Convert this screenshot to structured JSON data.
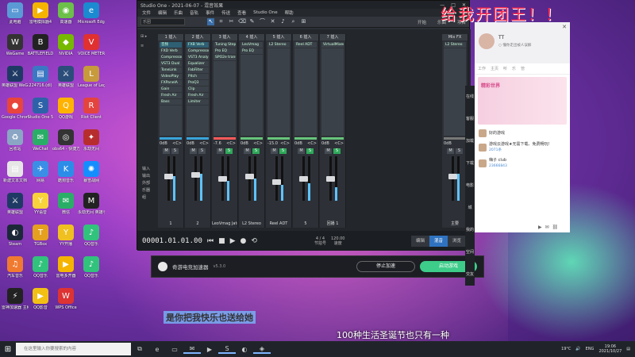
{
  "desktop_icons": [
    {
      "label": "此电脑",
      "glyph": "▭",
      "color": "#5b9bd5"
    },
    {
      "label": "雷电模拟器4",
      "glyph": "▶",
      "color": "#f5b400"
    },
    {
      "label": "高速器",
      "glyph": "◉",
      "color": "#6cc04a"
    },
    {
      "label": "Microsoft Edge",
      "glyph": "e",
      "color": "#1b8ad0"
    },
    {
      "label": "WeGame",
      "glyph": "W",
      "color": "#333"
    },
    {
      "label": "BATTLEFIELD",
      "glyph": "B",
      "color": "#222"
    },
    {
      "label": "NVIDIA",
      "glyph": "◆",
      "color": "#76b900"
    },
    {
      "label": "VOICE METER",
      "glyph": "V",
      "color": "#e03030"
    },
    {
      "label": "英雄联盟 WeGame版",
      "glyph": "⚔",
      "color": "#1e3a64"
    },
    {
      "label": "224716.(dl)",
      "glyph": "▤",
      "color": "#3b78c3"
    },
    {
      "label": "英雄联盟",
      "glyph": "⚔",
      "color": "#2b4d7a"
    },
    {
      "label": "League of Legends",
      "glyph": "L",
      "color": "#c79b3b"
    },
    {
      "label": "Google Chrome",
      "glyph": "●",
      "color": "#e8453c"
    },
    {
      "label": "Studio One 5",
      "glyph": "S",
      "color": "#2d62a8"
    },
    {
      "label": "QQ游戏",
      "glyph": "Q",
      "color": "#ffb300"
    },
    {
      "label": "Riot Client",
      "glyph": "R",
      "color": "#e3443d"
    },
    {
      "label": "回收站",
      "glyph": "♻",
      "color": "#8aa6c4"
    },
    {
      "label": "WeChat",
      "glyph": "✉",
      "color": "#2aae67"
    },
    {
      "label": "obs64 - 快捷方式",
      "glyph": "◎",
      "color": "#333"
    },
    {
      "label": "永劫无间",
      "glyph": "✦",
      "color": "#b72d2d"
    },
    {
      "label": "新建文本文档",
      "glyph": "▤",
      "color": "#e6e6e6"
    },
    {
      "label": "网易",
      "glyph": "✈",
      "color": "#3a8ee6"
    },
    {
      "label": "酷狗音乐",
      "glyph": "K",
      "color": "#2c8de8"
    },
    {
      "label": "暴雪战网",
      "glyph": "✺",
      "color": "#148eff"
    },
    {
      "label": "英雄联盟",
      "glyph": "⚔",
      "color": "#1e3a64"
    },
    {
      "label": "YY语音",
      "glyph": "Y",
      "color": "#f8d33b"
    },
    {
      "label": "微信",
      "glyph": "✉",
      "color": "#2aae67"
    },
    {
      "label": "永劫无间 英雄手册",
      "glyph": "M",
      "color": "#222"
    },
    {
      "label": "Steam",
      "glyph": "◐",
      "color": "#1b2838"
    },
    {
      "label": "TGBox",
      "glyph": "T",
      "color": "#e5a020"
    },
    {
      "label": "YY开播",
      "glyph": "Y",
      "color": "#f0c020"
    },
    {
      "label": "QQ音乐",
      "glyph": "♪",
      "color": "#31c27c"
    },
    {
      "label": "汽车音乐",
      "glyph": "♫",
      "color": "#f07a30"
    },
    {
      "label": "QQ音乐",
      "glyph": "♪",
      "color": "#31c27c"
    },
    {
      "label": "雷电多开器",
      "glyph": "▶",
      "color": "#f5b400"
    },
    {
      "label": "QQ音乐",
      "glyph": "♪",
      "color": "#31c27c"
    },
    {
      "label": "雷神加速器 主程序",
      "glyph": "⚡",
      "color": "#222"
    },
    {
      "label": "QQ影音",
      "glyph": "▶",
      "color": "#f2c014"
    },
    {
      "label": "WPS Office",
      "glyph": "W",
      "color": "#d33"
    }
  ],
  "window": {
    "title": "Studio One - 2021-06-07 - 混音效果",
    "menu": [
      "文件",
      "编辑",
      "乐曲",
      "音轨",
      "事件",
      "传送",
      "查看",
      "Studio One",
      "帮助"
    ],
    "preset": "乐团",
    "right_links": [
      "开始",
      "乐曲",
      "项目"
    ],
    "left_side": [
      "输入",
      "输出",
      "外部",
      "乐器",
      "组"
    ],
    "channels": [
      {
        "head": "1 插入",
        "slots": [
          "音频",
          "FXD Verb",
          "Compressor",
          "VST3 Dual",
          "ToneLink",
          "VideoPlay",
          "FXPanelA",
          "Gain",
          "Fresh Air",
          "Bass"
        ],
        "color": "#3aa4d9",
        "val": "0dB",
        "pan": "<C>",
        "m": false,
        "s": false,
        "lvl": 0.55,
        "fad": 0.45,
        "foot": "1",
        "footcls": ""
      },
      {
        "head": "2 插入",
        "slots": [
          "FXB Verb",
          "Compressor",
          "VST3 Analyse",
          "Equalizer",
          "FabFilter",
          "Pitch",
          "ProQ3",
          "Clip",
          "Fresh Air",
          "Limiter"
        ],
        "color": "#3aa4d9",
        "val": "0dB",
        "pan": "<C>",
        "m": false,
        "s": false,
        "lvl": 0.6,
        "fad": 0.4,
        "foot": "2",
        "footcls": ""
      },
      {
        "head": "3 插入",
        "slots": [
          "Tuning Steps",
          "Pro EQ",
          "SPO2e trans"
        ],
        "color": "#ff5a5a",
        "val": "-7.6",
        "pan": "<C>",
        "m": false,
        "s": true,
        "lvl": 0.45,
        "fad": 0.5,
        "foot": "LeoVmag Jate",
        "footcls": ""
      },
      {
        "head": "4 插入",
        "slots": [
          "LeoVmag",
          "Pro EQ"
        ],
        "color": "#66c47a",
        "val": "0dB",
        "pan": "<C>",
        "m": false,
        "s": true,
        "lvl": 0.5,
        "fad": 0.45,
        "foot": "L2 Stereo",
        "footcls": ""
      },
      {
        "head": "5 插入",
        "slots": [
          "L2 Stereo"
        ],
        "color": "#66c47a",
        "val": "-15.0",
        "pan": "<C>",
        "m": false,
        "s": true,
        "lvl": 0.35,
        "fad": 0.6,
        "foot": "Reel ADT",
        "footcls": ""
      },
      {
        "head": "6 插入",
        "slots": [
          "Reel ADT"
        ],
        "color": "#66c47a",
        "val": "0dB",
        "pan": "<C>",
        "m": false,
        "s": true,
        "lvl": 0.4,
        "fad": 0.5,
        "foot": "5",
        "footcls": ""
      },
      {
        "head": "7 插入",
        "slots": [
          "VirtualMixer"
        ],
        "color": "#66c47a",
        "val": "0dB",
        "pan": "<C>",
        "m": false,
        "s": true,
        "lvl": 0.3,
        "fad": 0.5,
        "foot": "回播 1",
        "footcls": ""
      },
      {
        "head": "Mix FX",
        "slots": [
          "L2 Stereo"
        ],
        "color": "#777",
        "val": "0dB",
        "pan": "",
        "m": false,
        "s": false,
        "lvl": 0.6,
        "fad": 0.45,
        "foot": "主要",
        "footcls": ""
      }
    ],
    "transport": {
      "time": "00001.01.01.00",
      "sig": "4 / 4",
      "sig_label": "节拍号",
      "tempo": "120.00",
      "tempo_label": "速度",
      "views": [
        "编辑",
        "混音",
        "浏览"
      ],
      "selected_view": "混音"
    }
  },
  "accelerator": {
    "name": "奇游电竞加速器",
    "version": "v5.3.0",
    "stop_label": "停止加速",
    "start_label": "启动游戏"
  },
  "chat": {
    "username": "TT",
    "subtitle": "○ 懂你走出被人误解",
    "tabs": [
      "工作",
      "主页",
      "听",
      "乐",
      "管"
    ],
    "banner_text": "精彩世界",
    "side_tabs": [
      "在线客服",
      "加载下载",
      "电影城",
      "我的空间",
      "交友"
    ],
    "rows": [
      {
        "title": "好的游戏",
        "sub": ""
      },
      {
        "title": "游戏云游戏★无需下载、免费畅玩!",
        "sub": "2071条"
      },
      {
        "title": "嗨子 club",
        "sub": "23666843"
      }
    ]
  },
  "overlay": {
    "big": "给我开团王！！",
    "sub1": "是你把我快乐也送给她",
    "sub2": "100种生活圣诞节也只有一种"
  },
  "taskbar": {
    "search_placeholder": "在这里输入你要搜索的内容",
    "weather": "19°C",
    "lang": "ENG",
    "time": "19:06",
    "date": "2021/10/27"
  }
}
